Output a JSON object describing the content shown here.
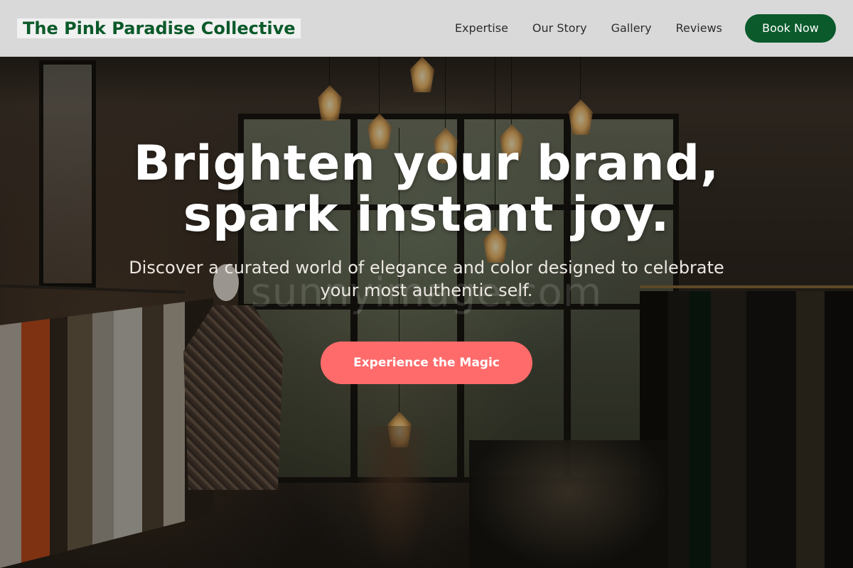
{
  "header": {
    "logo_text": "The Pink Paradise Collective",
    "nav": [
      {
        "label": "Expertise"
      },
      {
        "label": "Our Story"
      },
      {
        "label": "Gallery"
      },
      {
        "label": "Reviews"
      }
    ],
    "cta_label": "Book Now"
  },
  "hero": {
    "headline": "Brighten your brand, spark instant joy.",
    "subtitle": "Discover a curated world of elegance and color designed to celebrate your most authentic self.",
    "cta_label": "Experience the Magic",
    "watermark": "sunnyimage.com"
  },
  "colors": {
    "brand_green": "#0a5a2c",
    "cta_coral": "#ff6b6b",
    "header_bg": "#e1e1e1"
  }
}
